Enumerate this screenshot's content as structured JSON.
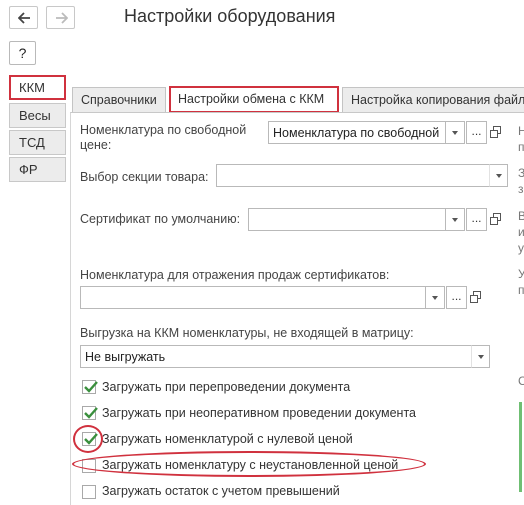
{
  "window": {
    "title": "Настройки оборудования",
    "help_label": "?"
  },
  "side_tabs": [
    {
      "label": "ККМ"
    },
    {
      "label": "Весы"
    },
    {
      "label": "ТСД"
    },
    {
      "label": "ФР"
    }
  ],
  "top_tabs": [
    {
      "label": "Справочники"
    },
    {
      "label": "Настройки обмена с ККМ"
    },
    {
      "label": "Настройка копирования файл"
    }
  ],
  "form": {
    "nomenclature_free_price": {
      "label_line1": "Номенклатура по свободной",
      "label_line2": "цене:",
      "value": "Номенклатура по свободной"
    },
    "section_select": {
      "label": "Выбор секции товара:",
      "value": ""
    },
    "default_certificate": {
      "label": "Сертификат по умолчанию:",
      "value": ""
    },
    "certificate_sales_nomenclature": {
      "label": "Номенклатура для отражения продаж сертификатов:",
      "value": ""
    },
    "export_nomatrix": {
      "label": "Выгрузка на ККМ номенклатуры, не входящей в матрицу:",
      "value": "Не выгружать"
    },
    "more_button_label": "...",
    "checkboxes": [
      {
        "label": "Загружать при перепроведении документа",
        "checked": true
      },
      {
        "label": "Загружать при неоперативном проведении документа",
        "checked": true
      },
      {
        "label": "Загружать номенклатурой с нулевой ценой",
        "checked": true
      },
      {
        "label": "Загружать номенклатуру с неустановленной ценой",
        "checked": false
      },
      {
        "label": "Загружать остаток с учетом превышений",
        "checked": false
      }
    ]
  },
  "right_edge_fragments": [
    "Н",
    "п",
    "З",
    "з",
    "В",
    "и",
    "у",
    "У",
    "п",
    "С"
  ],
  "colors": {
    "highlight_red": "#d0313e",
    "check_green": "#3a8f3d",
    "accent_green": "#6fbf73"
  }
}
